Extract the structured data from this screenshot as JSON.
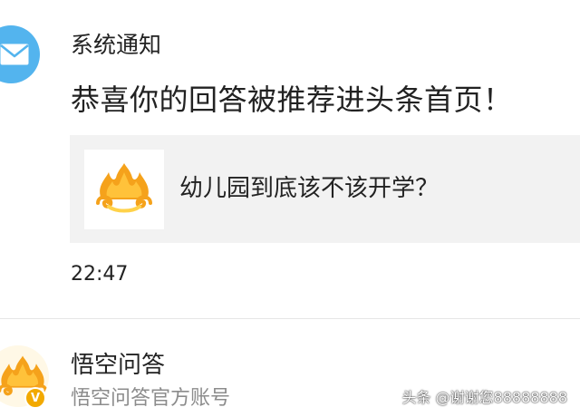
{
  "notice": {
    "icon": "mail-icon",
    "sender": "系统通知",
    "message": "恭喜你的回答被推荐进头条首页！",
    "card": {
      "thumbnail_icon": "wukong-logo-icon",
      "title": "幼儿园到底该不该开学？"
    },
    "time": "22:47"
  },
  "account": {
    "avatar_icon": "wukong-logo-icon",
    "badge": "V",
    "name": "悟空问答",
    "description": "悟空问答官方账号"
  },
  "watermark": "头条 @谢谢您88888888",
  "colors": {
    "notice_avatar": "#53b4ee",
    "card_background": "#f2f2f2",
    "logo_orange": "#f5a21b",
    "logo_yellow": "#ffd24a",
    "badge": "#f2a900",
    "secondary_text": "#8c8c8c"
  }
}
